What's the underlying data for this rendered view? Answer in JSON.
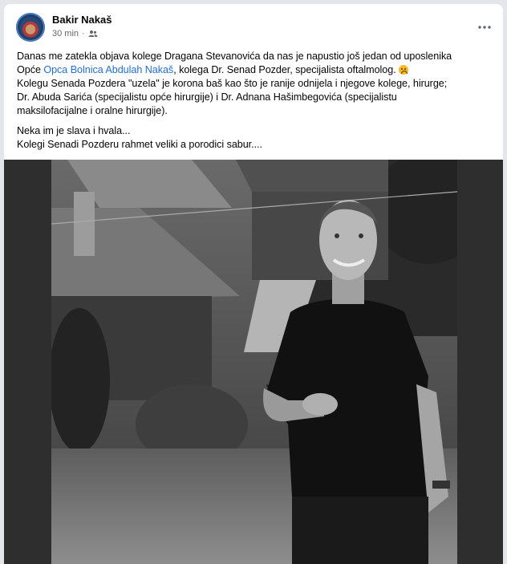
{
  "post": {
    "author": "Bakir Nakaš",
    "time": "30 min",
    "audience_icon": "friends-icon",
    "more_icon": "more-horizontal-icon",
    "lines": {
      "l1": "Danas me zatekla objava kolege Dragana Stevanovića da nas je napustio još jedan od uposlenika",
      "l2_a": "Opće ",
      "l2_link": "Opca Bolnica Abdulah Nakaš",
      "l2_b": ", kolega Dr. Senad Pozder, specijalista oftalmolog.",
      "l3": "Kolegu Senada Pozdera \"uzela\" je korona baš kao što je ranije odnijela  i njegove kolege, hirurge;",
      "l4": "Dr. Abuda Sarića (specijalistu opće hirurgije) i Dr. Adnana Hašimbegovića (specijalistu",
      "l5": "maksilofacijalne i oralne hirurgije).",
      "l6": "Neka im je slava i hvala...",
      "l7": "Kolegi Senadi Pozderu rahmet veliki a porodici sabur...."
    },
    "emoji": "sad-face-emoji",
    "colors": {
      "link": "#216fdb",
      "meta": "#65676b",
      "bg": "#e4e6eb"
    }
  }
}
